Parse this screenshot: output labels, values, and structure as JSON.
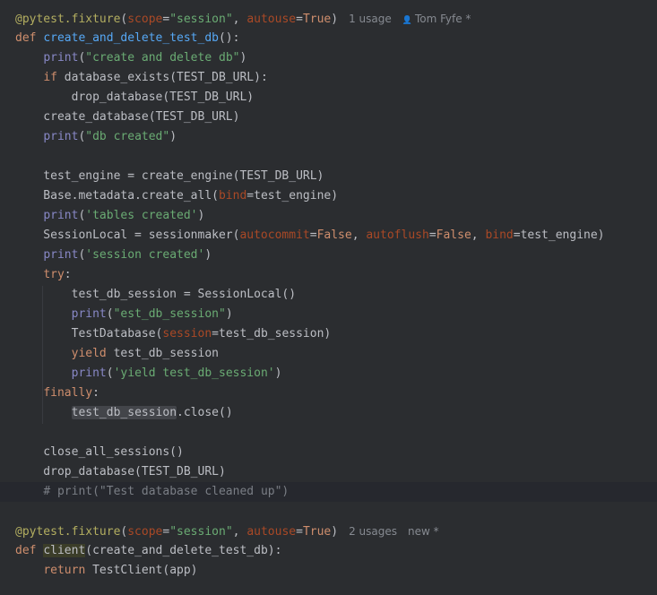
{
  "editor": {
    "lines": [
      {
        "tokens": [
          {
            "t": "@pytest.fixture",
            "c": "dec"
          },
          {
            "t": "(",
            "c": ""
          },
          {
            "t": "scope",
            "c": "kwarg"
          },
          {
            "t": "=",
            "c": ""
          },
          {
            "t": "\"session\"",
            "c": "str"
          },
          {
            "t": ", ",
            "c": ""
          },
          {
            "t": "autouse",
            "c": "kwarg"
          },
          {
            "t": "=",
            "c": ""
          },
          {
            "t": "True",
            "c": "kw"
          },
          {
            "t": ")",
            "c": ""
          }
        ],
        "hint": {
          "usages": "1 usage",
          "author": "Tom Fyfe *"
        }
      },
      {
        "tokens": [
          {
            "t": "def ",
            "c": "kw"
          },
          {
            "t": "create_and_delete_test_db",
            "c": "defname"
          },
          {
            "t": "():",
            "c": ""
          }
        ]
      },
      {
        "tokens": [
          {
            "t": "    ",
            "c": ""
          },
          {
            "t": "print",
            "c": "builtin"
          },
          {
            "t": "(",
            "c": ""
          },
          {
            "t": "\"create and delete db\"",
            "c": "str"
          },
          {
            "t": ")",
            "c": ""
          }
        ]
      },
      {
        "tokens": [
          {
            "t": "    ",
            "c": ""
          },
          {
            "t": "if ",
            "c": "kw"
          },
          {
            "t": "database_exists(TEST_DB_URL):",
            "c": ""
          }
        ]
      },
      {
        "tokens": [
          {
            "t": "        drop_database(TEST_DB_URL)",
            "c": ""
          }
        ]
      },
      {
        "tokens": [
          {
            "t": "    create_database(TEST_DB_URL)",
            "c": ""
          }
        ]
      },
      {
        "tokens": [
          {
            "t": "    ",
            "c": ""
          },
          {
            "t": "print",
            "c": "builtin"
          },
          {
            "t": "(",
            "c": ""
          },
          {
            "t": "\"db created\"",
            "c": "str"
          },
          {
            "t": ")",
            "c": ""
          }
        ]
      },
      {
        "tokens": []
      },
      {
        "tokens": [
          {
            "t": "    test_engine = create_engine(TEST_DB_URL)",
            "c": ""
          }
        ]
      },
      {
        "tokens": [
          {
            "t": "    Base.metadata.create_all(",
            "c": ""
          },
          {
            "t": "bind",
            "c": "kwarg"
          },
          {
            "t": "=test_engine)",
            "c": ""
          }
        ]
      },
      {
        "tokens": [
          {
            "t": "    ",
            "c": ""
          },
          {
            "t": "print",
            "c": "builtin"
          },
          {
            "t": "(",
            "c": ""
          },
          {
            "t": "'tables created'",
            "c": "str"
          },
          {
            "t": ")",
            "c": ""
          }
        ]
      },
      {
        "tokens": [
          {
            "t": "    SessionLocal = sessionmaker(",
            "c": ""
          },
          {
            "t": "autocommit",
            "c": "kwarg"
          },
          {
            "t": "=",
            "c": ""
          },
          {
            "t": "False",
            "c": "kw"
          },
          {
            "t": ", ",
            "c": ""
          },
          {
            "t": "autoflush",
            "c": "kwarg"
          },
          {
            "t": "=",
            "c": ""
          },
          {
            "t": "False",
            "c": "kw"
          },
          {
            "t": ", ",
            "c": ""
          },
          {
            "t": "bind",
            "c": "kwarg"
          },
          {
            "t": "=test_engine)",
            "c": ""
          }
        ]
      },
      {
        "tokens": [
          {
            "t": "    ",
            "c": ""
          },
          {
            "t": "print",
            "c": "builtin"
          },
          {
            "t": "(",
            "c": ""
          },
          {
            "t": "'session created'",
            "c": "str"
          },
          {
            "t": ")",
            "c": ""
          }
        ]
      },
      {
        "tokens": [
          {
            "t": "    ",
            "c": ""
          },
          {
            "t": "try",
            "c": "kw"
          },
          {
            "t": ":",
            "c": ""
          }
        ]
      },
      {
        "tokens": [
          {
            "t": "        test_db_session = SessionLocal()",
            "c": ""
          }
        ]
      },
      {
        "tokens": [
          {
            "t": "        ",
            "c": ""
          },
          {
            "t": "print",
            "c": "builtin"
          },
          {
            "t": "(",
            "c": ""
          },
          {
            "t": "\"est_db_session\"",
            "c": "str"
          },
          {
            "t": ")",
            "c": ""
          }
        ]
      },
      {
        "tokens": [
          {
            "t": "        TestDatabase(",
            "c": ""
          },
          {
            "t": "session",
            "c": "kwarg"
          },
          {
            "t": "=test_db_session)",
            "c": ""
          }
        ]
      },
      {
        "tokens": [
          {
            "t": "        ",
            "c": ""
          },
          {
            "t": "yield ",
            "c": "kw"
          },
          {
            "t": "test_db_session",
            "c": ""
          }
        ]
      },
      {
        "tokens": [
          {
            "t": "        ",
            "c": ""
          },
          {
            "t": "print",
            "c": "builtin"
          },
          {
            "t": "(",
            "c": ""
          },
          {
            "t": "'yield test_db_session'",
            "c": "str"
          },
          {
            "t": ")",
            "c": ""
          }
        ]
      },
      {
        "tokens": [
          {
            "t": "    ",
            "c": ""
          },
          {
            "t": "finally",
            "c": "kw"
          },
          {
            "t": ":",
            "c": ""
          }
        ]
      },
      {
        "tokens": [
          {
            "t": "        ",
            "c": ""
          },
          {
            "t": "test_db_session",
            "c": "hl"
          },
          {
            "t": ".close()",
            "c": ""
          }
        ]
      },
      {
        "tokens": []
      },
      {
        "tokens": [
          {
            "t": "    close_all_sessions()",
            "c": ""
          }
        ]
      },
      {
        "tokens": [
          {
            "t": "    drop_database(TEST_DB_URL)",
            "c": ""
          }
        ]
      },
      {
        "tokens": [
          {
            "t": "    ",
            "c": ""
          },
          {
            "t": "# print(\"Test database cleaned up\")",
            "c": "cmt"
          }
        ],
        "current": true
      },
      {
        "tokens": []
      },
      {
        "tokens": [
          {
            "t": "@pytest.fixture",
            "c": "dec"
          },
          {
            "t": "(",
            "c": ""
          },
          {
            "t": "scope",
            "c": "kwarg"
          },
          {
            "t": "=",
            "c": ""
          },
          {
            "t": "\"session\"",
            "c": "str"
          },
          {
            "t": ", ",
            "c": ""
          },
          {
            "t": "autouse",
            "c": "kwarg"
          },
          {
            "t": "=",
            "c": ""
          },
          {
            "t": "True",
            "c": "kw"
          },
          {
            "t": ")",
            "c": ""
          }
        ],
        "hint": {
          "usages": "2 usages",
          "author": "new *"
        }
      },
      {
        "tokens": [
          {
            "t": "def ",
            "c": "kw"
          },
          {
            "t": "client",
            "c": "usage-hl defname"
          },
          {
            "t": "(create_and_delete_test_db):",
            "c": ""
          }
        ]
      },
      {
        "tokens": [
          {
            "t": "    ",
            "c": ""
          },
          {
            "t": "return ",
            "c": "kw"
          },
          {
            "t": "TestClient(app)",
            "c": ""
          }
        ]
      }
    ]
  },
  "colors": {
    "background": "#2b2d30",
    "text": "#bcbec4",
    "keyword": "#cf8e6d",
    "string": "#6aab73",
    "decorator": "#b3ae60",
    "kwarg": "#aa4926",
    "comment": "#7a7e85",
    "builtin": "#8888c6"
  },
  "icons": {
    "author": "person-icon"
  }
}
